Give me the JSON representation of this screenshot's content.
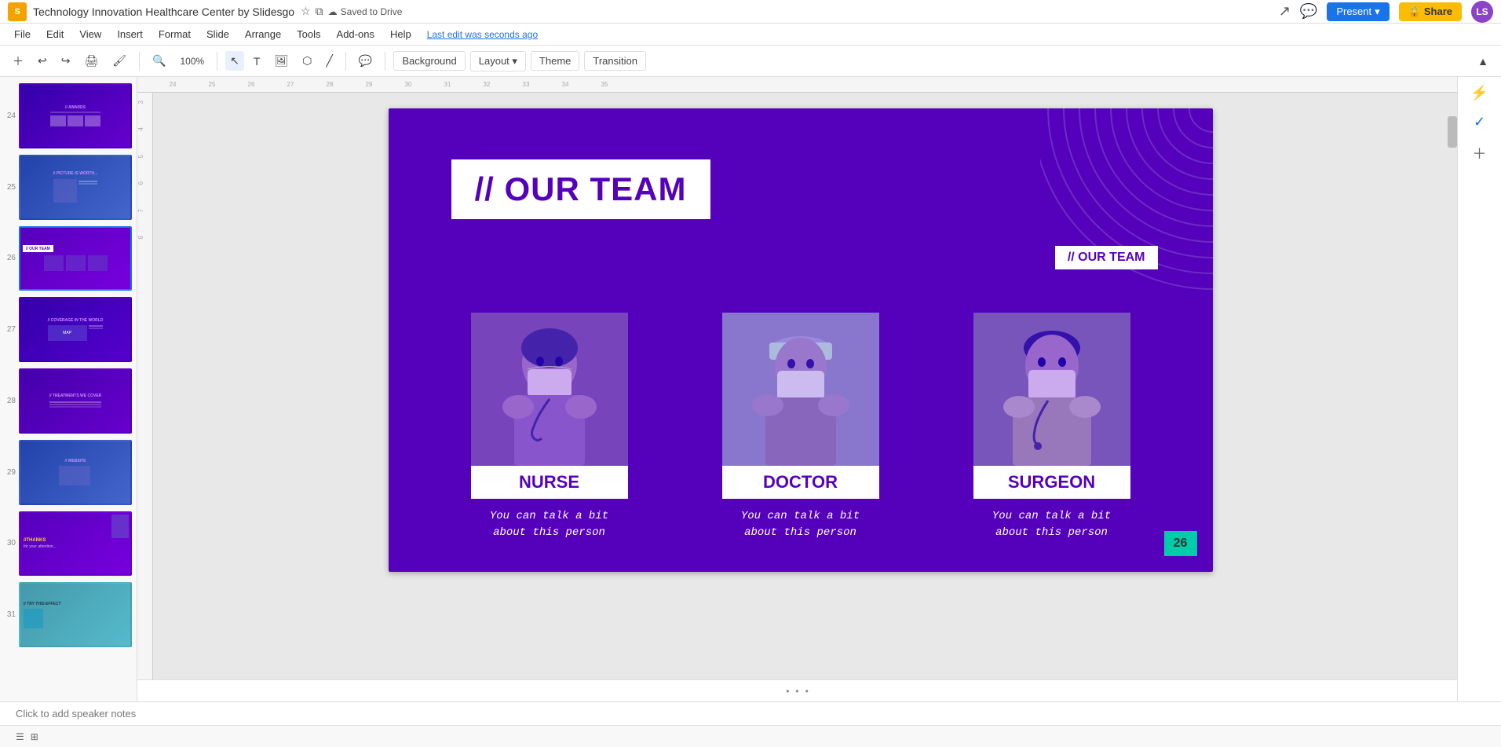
{
  "app": {
    "logo": "S",
    "doc_title": "Technology Innovation Healthcare Center by Slidesgo",
    "cloud_save": "Saved to Drive",
    "last_edit": "Last edit was seconds ago"
  },
  "header": {
    "present_label": "Present",
    "share_label": "Share",
    "avatar_initials": "LS"
  },
  "menu": {
    "items": [
      "File",
      "Edit",
      "View",
      "Insert",
      "Format",
      "Slide",
      "Arrange",
      "Tools",
      "Add-ons",
      "Help"
    ]
  },
  "toolbar": {
    "background_label": "Background",
    "layout_label": "Layout",
    "theme_label": "Theme",
    "transition_label": "Transition"
  },
  "slide": {
    "slide_number": "26",
    "title_prefix": "// ",
    "title": "OUR TEAM",
    "corner_label": "// OUR TEAM",
    "members": [
      {
        "name": "NURSE",
        "description": "You can talk a bit\nabout this person"
      },
      {
        "name": "DOCTOR",
        "description": "You can talk a bit\nabout this person"
      },
      {
        "name": "SURGEON",
        "description": "You can talk a bit\nabout this person"
      }
    ]
  },
  "thumbnails": [
    {
      "num": "24",
      "label": "AWARDS"
    },
    {
      "num": "25",
      "label": "PICTURE IS WORTH..."
    },
    {
      "num": "26",
      "label": "OUR TEAM",
      "active": true
    },
    {
      "num": "27",
      "label": "COVERAGE IN THE WORLD"
    },
    {
      "num": "28",
      "label": "TREATMENTS WE COVER"
    },
    {
      "num": "29",
      "label": "WEBSITE"
    },
    {
      "num": "30",
      "label": "THANKS"
    },
    {
      "num": "31",
      "label": "TRY THIS EFFECT"
    }
  ],
  "notes_placeholder": "Click to add speaker notes"
}
